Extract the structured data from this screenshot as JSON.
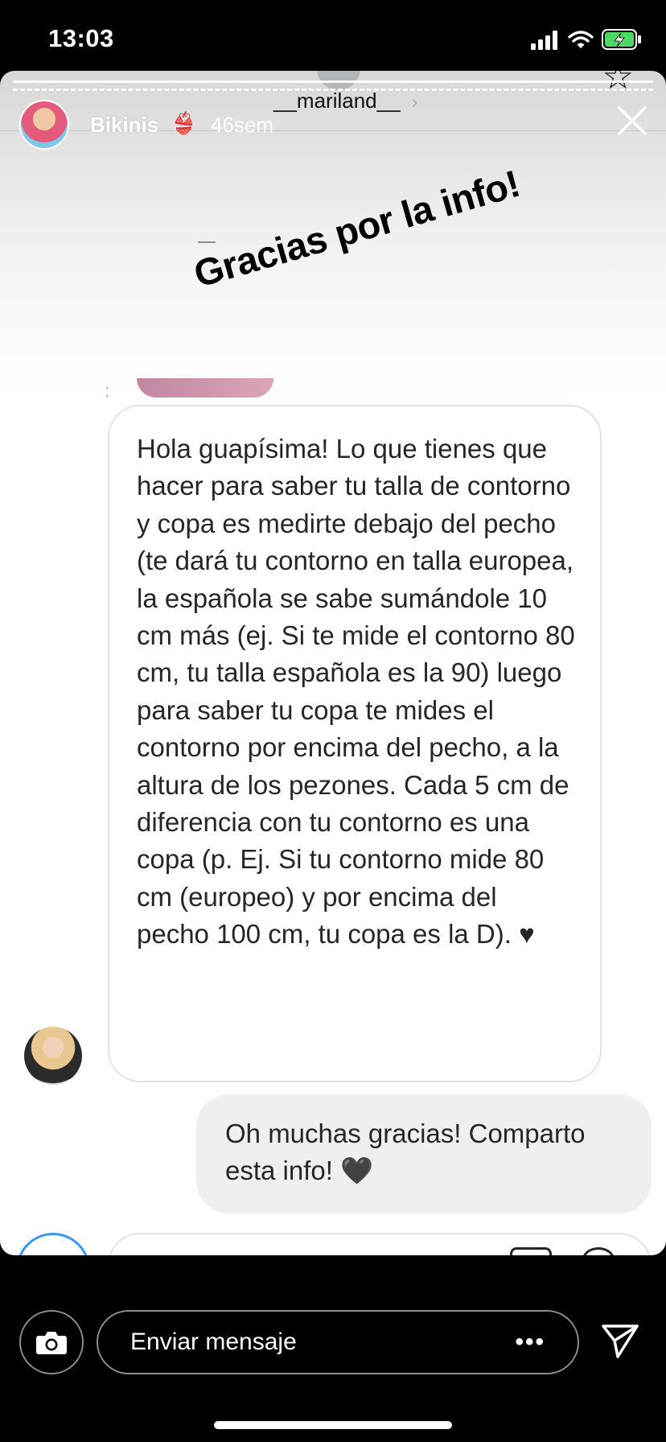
{
  "status_bar": {
    "time": "13:03",
    "icons": [
      "signal-icon",
      "wifi-icon",
      "battery-charging-icon"
    ],
    "battery_color": "#4cd964"
  },
  "story": {
    "ghost_username": "__mariland__",
    "user": {
      "name": "Bikinis",
      "emoji": "👙",
      "time_ago": "46sem"
    },
    "sticker_text": "Gracias por la info!",
    "messages": [
      {
        "direction": "received",
        "text": "Hola guapísima! Lo que tienes que hacer para saber tu talla de contorno y copa es medirte debajo del pecho (te dará tu contorno en talla europea, la española se sabe sumándole 10 cm más (ej. Si te mide el contorno 80 cm, tu talla española es la 90) luego para saber tu copa te mides el contorno por encima del pecho, a la altura de los pezones. Cada 5 cm de diferencia con tu contorno es una copa (p. Ej. Si tu contorno mide 80 cm (europeo) y por encima del pecho 100 cm, tu copa es la D). ♥"
      },
      {
        "direction": "sent",
        "text": "Oh muchas gracias! Comparto esta info! 🖤"
      }
    ]
  },
  "bottom_bar": {
    "message_placeholder": "Enviar mensaje",
    "more_label": "•••",
    "icons": [
      "camera-icon",
      "send-icon"
    ]
  }
}
